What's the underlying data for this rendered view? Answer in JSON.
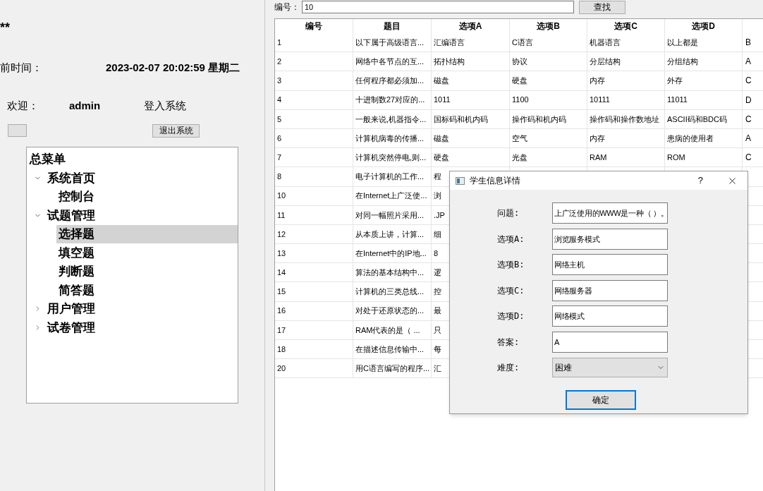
{
  "header": {
    "stars": "**",
    "time_label": "前时间：",
    "time_value": "2023-02-07 20:02:59 星期二",
    "welcome_label": "欢迎：",
    "user": "admin",
    "status": "登入系统",
    "logout_button": "退出系统"
  },
  "menu": {
    "title": "总菜单",
    "items": [
      {
        "label": "系统首页",
        "expanded": true,
        "selected": false,
        "children": [
          {
            "label": "控制台",
            "selected": false
          }
        ]
      },
      {
        "label": "试题管理",
        "expanded": true,
        "selected": false,
        "children": [
          {
            "label": "选择题",
            "selected": true
          },
          {
            "label": "填空题",
            "selected": false
          },
          {
            "label": "判断题",
            "selected": false
          },
          {
            "label": "简答题",
            "selected": false
          }
        ]
      },
      {
        "label": "用户管理",
        "expanded": false,
        "selected": false
      },
      {
        "label": "试卷管理",
        "expanded": false,
        "selected": false
      }
    ]
  },
  "search": {
    "label": "编号：",
    "value": "10",
    "button": "查找"
  },
  "table": {
    "columns": [
      "编号",
      "题目",
      "选项A",
      "选项B",
      "选项C",
      "选项D"
    ],
    "rows": [
      {
        "id": "1",
        "title": "以下属于高级语言...",
        "a": "汇编语言",
        "b": "C语言",
        "c": "机器语言",
        "d": "以上都是",
        "answer": "B"
      },
      {
        "id": "2",
        "title": "网络中各节点的互...",
        "a": "拓扑结构",
        "b": "协议",
        "c": "分层结构",
        "d": "分组结构",
        "answer": "A"
      },
      {
        "id": "3",
        "title": "任何程序都必须加...",
        "a": "磁盘",
        "b": "硬盘",
        "c": "内存",
        "d": "外存",
        "answer": "C"
      },
      {
        "id": "4",
        "title": "十进制数27对应的...",
        "a": "1011",
        "b": "1100",
        "c": "10111",
        "d": "11011",
        "answer": "D"
      },
      {
        "id": "5",
        "title": "一般来说,机器指令...",
        "a": "国标码和机内码",
        "b": "操作码和机内码",
        "c": "操作码和操作数地址",
        "d": "ASCII码和BDC码",
        "answer": "C"
      },
      {
        "id": "6",
        "title": "计算机病毒的传播...",
        "a": "磁盘",
        "b": "空气",
        "c": "内存",
        "d": "患病的使用者",
        "answer": "A"
      },
      {
        "id": "7",
        "title": "计算机突然停电,则...",
        "a": "硬盘",
        "b": "光盘",
        "c": "RAM",
        "d": "ROM",
        "answer": "C"
      },
      {
        "id": "8",
        "title": "电子计算机的工作...",
        "a": "程"
      },
      {
        "id": "10",
        "title": "在Internet上广泛使...",
        "a": "浏"
      },
      {
        "id": "11",
        "title": "对同一幅照片采用...",
        "a": ".JP"
      },
      {
        "id": "12",
        "title": "从本质上讲，计算...",
        "a": "细"
      },
      {
        "id": "13",
        "title": "在Internet中的IP地...",
        "a": "8"
      },
      {
        "id": "14",
        "title": "算法的基本结构中...",
        "a": "逻"
      },
      {
        "id": "15",
        "title": "计算机的三类总线...",
        "a": "控"
      },
      {
        "id": "16",
        "title": "对处于还原状态的...",
        "a": "最"
      },
      {
        "id": "17",
        "title": "RAM代表的是（ ...",
        "a": "只"
      },
      {
        "id": "18",
        "title": "在描述信息传输中...",
        "a": "每"
      },
      {
        "id": "20",
        "title": "用C语言编写的程序...",
        "a": "汇"
      }
    ]
  },
  "dialog": {
    "title": "学生信息详情",
    "help": "?",
    "fields": [
      {
        "kind": "text",
        "label": "问题:",
        "value": "上广泛使用的WWW是一种（   ）。"
      },
      {
        "kind": "text",
        "label": "选项A:",
        "value": "浏览服务模式"
      },
      {
        "kind": "text",
        "label": "选项B:",
        "value": "网络主机"
      },
      {
        "kind": "text",
        "label": "选项C:",
        "value": "网络服务器"
      },
      {
        "kind": "text",
        "label": "选项D:",
        "value": "网络模式"
      },
      {
        "kind": "text",
        "label": "答案:",
        "value": "A"
      },
      {
        "kind": "select",
        "label": "难度:",
        "value": "困难"
      }
    ],
    "ok_button": "确定"
  }
}
